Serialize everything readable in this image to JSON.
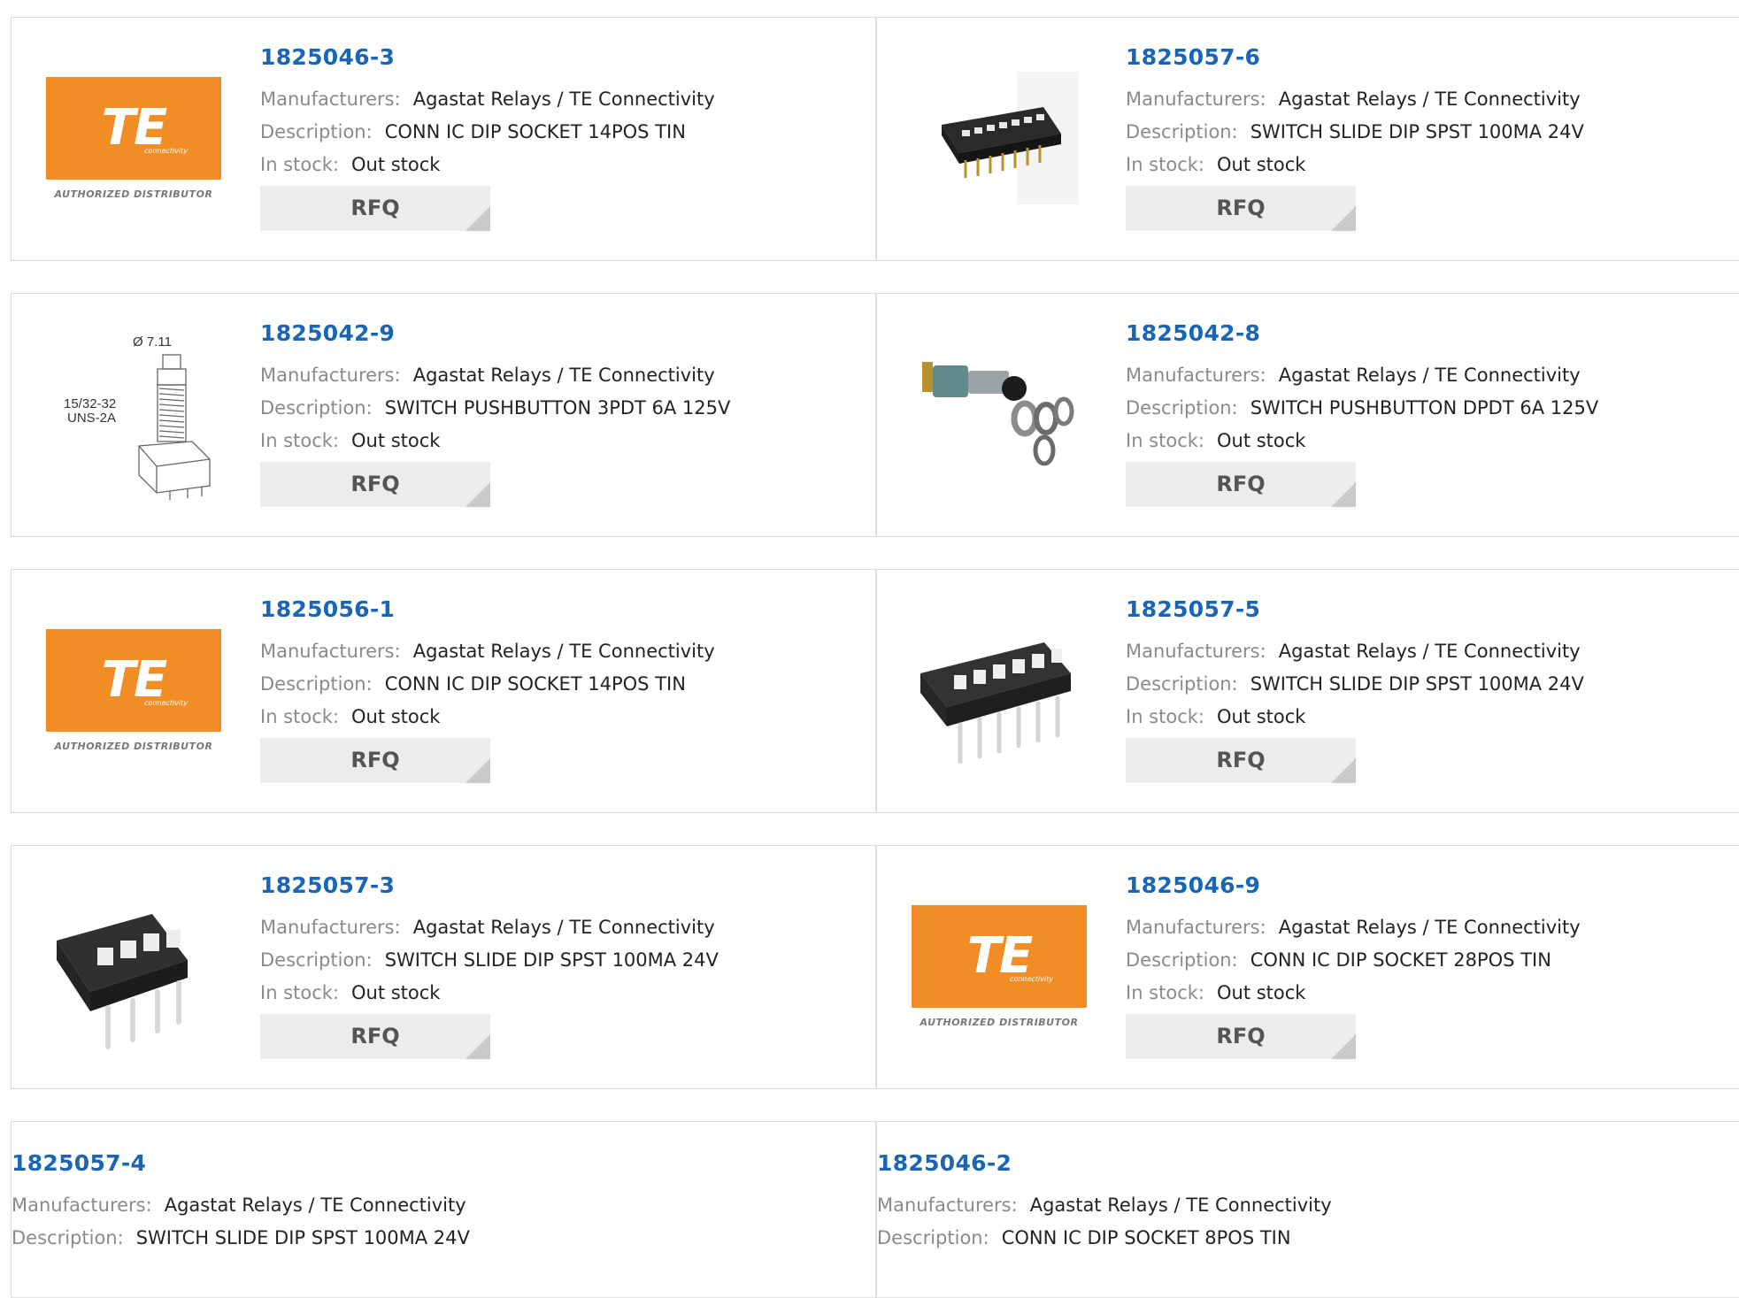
{
  "labels": {
    "manufacturers": "Manufacturers:",
    "description": "Description:",
    "in_stock": "In stock:",
    "rfq": "RFQ"
  },
  "colors": {
    "part_number": "#1a66b5",
    "rfq_bg": "#ececec",
    "te_orange": "#f28c24"
  },
  "products": [
    {
      "part": "1825046-3",
      "manufacturer": "Agastat Relays / TE Connectivity",
      "description": "CONN IC DIP SOCKET 14POS TIN",
      "stock": "Out stock",
      "image": "te-authorized-distributor-logo"
    },
    {
      "part": "1825057-6",
      "manufacturer": "Agastat Relays / TE Connectivity",
      "description": "SWITCH SLIDE DIP SPST 100MA 24V",
      "stock": "Out stock",
      "image": "dip-switch-8pos-photo"
    },
    {
      "part": "1825042-9",
      "manufacturer": "Agastat Relays / TE Connectivity",
      "description": "SWITCH PUSHBUTTON 3PDT 6A 125V",
      "stock": "Out stock",
      "image": "pushbutton-drawing"
    },
    {
      "part": "1825042-8",
      "manufacturer": "Agastat Relays / TE Connectivity",
      "description": "SWITCH PUSHBUTTON DPDT 6A 125V",
      "stock": "Out stock",
      "image": "pushbutton-photo"
    },
    {
      "part": "1825056-1",
      "manufacturer": "Agastat Relays / TE Connectivity",
      "description": "CONN IC DIP SOCKET 14POS TIN",
      "stock": "Out stock",
      "image": "te-authorized-distributor-logo"
    },
    {
      "part": "1825057-5",
      "manufacturer": "Agastat Relays / TE Connectivity",
      "description": "SWITCH SLIDE DIP SPST 100MA 24V",
      "stock": "Out stock",
      "image": "dip-switch-6pos-photo"
    },
    {
      "part": "1825057-3",
      "manufacturer": "Agastat Relays / TE Connectivity",
      "description": "SWITCH SLIDE DIP SPST 100MA 24V",
      "stock": "Out stock",
      "image": "dip-switch-4pos-photo"
    },
    {
      "part": "1825046-9",
      "manufacturer": "Agastat Relays / TE Connectivity",
      "description": "CONN IC DIP SOCKET 28POS TIN",
      "stock": "Out stock",
      "image": "te-authorized-distributor-logo"
    },
    {
      "part": "1825057-4",
      "manufacturer": "Agastat Relays / TE Connectivity",
      "description": "SWITCH SLIDE DIP SPST 100MA 24V",
      "stock": "",
      "image": ""
    },
    {
      "part": "1825046-2",
      "manufacturer": "Agastat Relays / TE Connectivity",
      "description": "CONN IC DIP SOCKET 8POS TIN",
      "stock": "",
      "image": ""
    }
  ],
  "te_logo": {
    "mark": "TE",
    "sub": "connectivity",
    "authorized": "AUTHORIZED DISTRIBUTOR"
  },
  "drawing_labels": {
    "diameter": "Ø 7.11",
    "thread_line1": "15/32-32",
    "thread_line2": "UNS-2A"
  }
}
